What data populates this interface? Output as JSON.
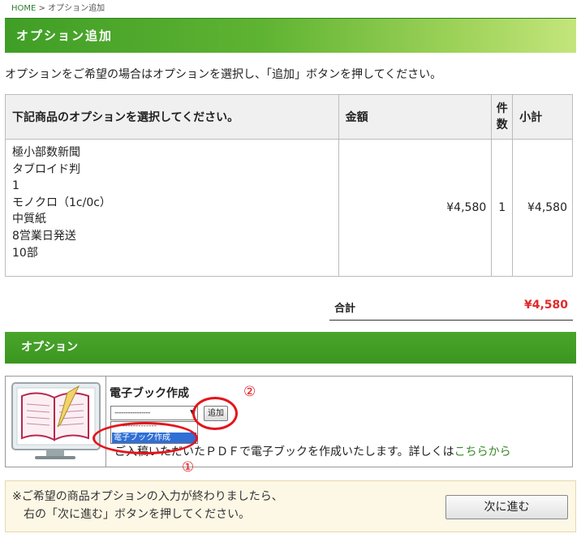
{
  "breadcrumb": {
    "home": "HOME",
    "sep": ">",
    "current": "オプション追加"
  },
  "header": {
    "title": "オプション追加"
  },
  "intro": "オプションをご希望の場合はオプションを選択し、「追加」ボタンを押してください。",
  "items_table": {
    "headers": {
      "product": "下記商品のオプションを選択してください。",
      "price": "金額",
      "qty_line1": "件",
      "qty_line2": "数",
      "subtotal": "小計"
    },
    "row": {
      "specs": [
        "極小部数新聞",
        "タブロイド判",
        "1",
        "モノクロ（1c/0c）",
        "中質紙",
        "8営業日発送",
        "10部"
      ],
      "price": "¥4,580",
      "qty": "1",
      "subtotal": "¥4,580"
    }
  },
  "total": {
    "label": "合計",
    "value": "¥4,580"
  },
  "options": {
    "bar_title": "オプション",
    "item": {
      "title": "電子ブック作成",
      "select_value": "----------------",
      "dropdown_options": [
        "----------------",
        "電子ブック作成"
      ],
      "add_label": "追加",
      "description_prefix": "ご入稿いただいたＰＤＦで電子ブックを作成いたします。詳しくは",
      "description_link": "こちらから"
    }
  },
  "annotations": {
    "mark1": "①",
    "mark2": "②",
    "color": "#e4141b"
  },
  "notice": {
    "line1": "※ご希望の商品オプションの入力が終わりましたら、",
    "line2": "　右の「次に進む」ボタンを押してください。",
    "next_label": "次に進む"
  },
  "colors": {
    "accent": "#3f9e26",
    "total": "#e12a2a",
    "link": "#3a8a2a"
  }
}
